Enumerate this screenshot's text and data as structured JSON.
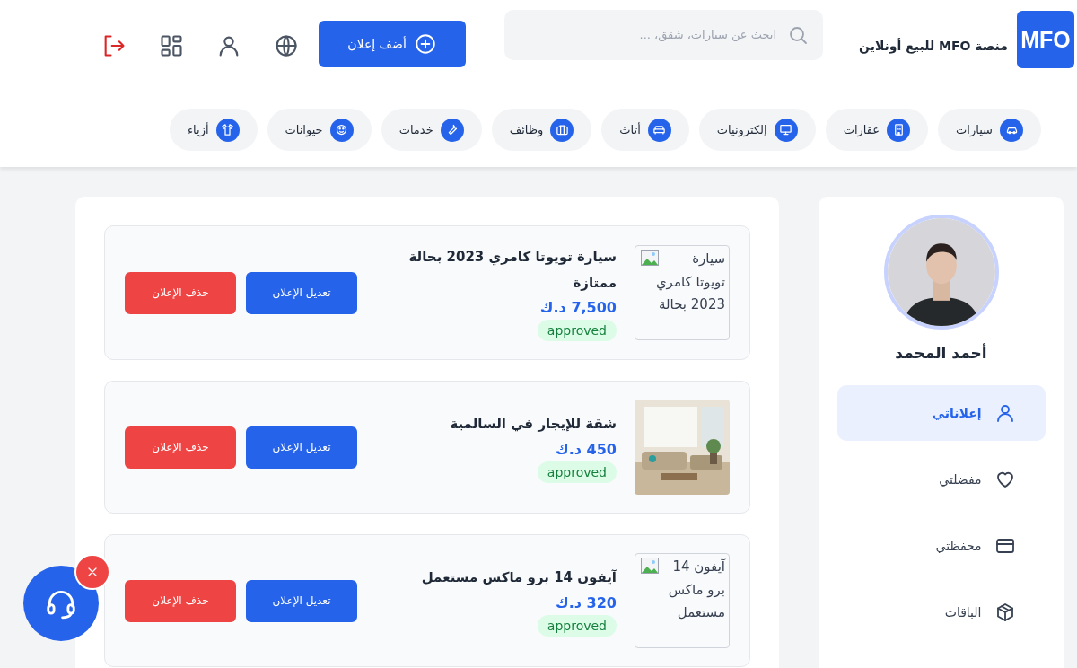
{
  "brand": {
    "logo": "MFO",
    "name": "منصة MFO للبيع أونلاين"
  },
  "search": {
    "placeholder": "ابحث عن سيارات، شقق، ..."
  },
  "add_button": "أضف إعلان",
  "categories": [
    {
      "label": "سيارات"
    },
    {
      "label": "عقارات"
    },
    {
      "label": "إلكترونيات"
    },
    {
      "label": "أثاث"
    },
    {
      "label": "وظائف"
    },
    {
      "label": "خدمات"
    },
    {
      "label": "حيوانات"
    },
    {
      "label": "أزياء"
    }
  ],
  "profile": {
    "name": "أحمد المحمد"
  },
  "sidebar": {
    "items": [
      {
        "label": "إعلاناتي",
        "selected": true
      },
      {
        "label": "مفضلتي",
        "selected": false
      },
      {
        "label": "محفظتي",
        "selected": false
      },
      {
        "label": "الباقات",
        "selected": false
      }
    ]
  },
  "ads": [
    {
      "title": "سيارة تويوتا كامري 2023 بحالة ممتازة",
      "price": "7,500 د.ك",
      "status": "approved",
      "image": {
        "kind": "broken",
        "alt_text": "سيارة تويوتا كامري 2023 بحالة"
      },
      "buttons": [
        "تعديل الإعلان",
        "حذف الإعلان"
      ]
    },
    {
      "title": "شقة للإيجار في السالمية",
      "price": "450 د.ك",
      "status": "approved",
      "image": {
        "kind": "picture"
      },
      "buttons": [
        "تعديل الإعلان",
        "حذف الإعلان"
      ]
    },
    {
      "title": "آيفون 14 برو ماكس مستعمل",
      "price": "320 د.ك",
      "status": "approved",
      "image": {
        "kind": "broken",
        "alt_text": "آيفون 14 برو ماكس مستعمل"
      },
      "buttons": [
        "تعديل الإعلان",
        "حذف الإعلان"
      ]
    }
  ]
}
